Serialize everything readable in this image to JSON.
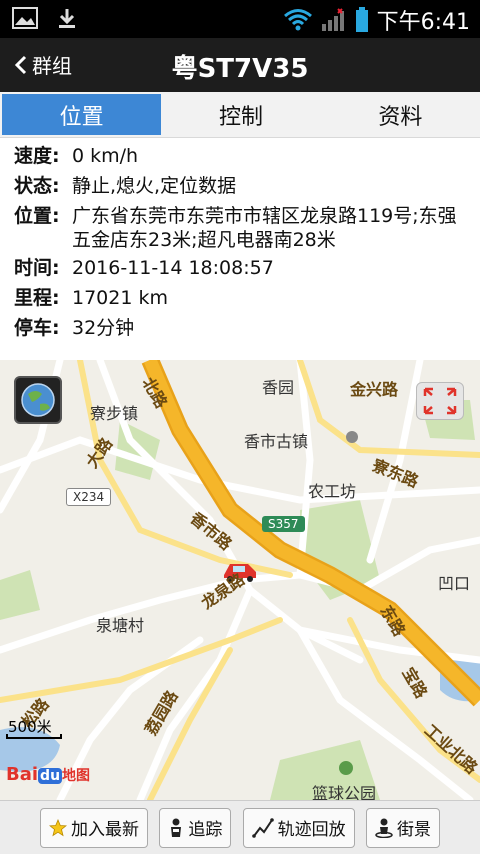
{
  "status_bar": {
    "time": "下午6:41",
    "icons": [
      "image-icon",
      "download-icon",
      "wifi-icon",
      "signal-icon",
      "battery-icon"
    ]
  },
  "header": {
    "back_label": "群组",
    "title": "粤ST7V35"
  },
  "tabs": [
    {
      "label": "位置",
      "active": true
    },
    {
      "label": "控制",
      "active": false
    },
    {
      "label": "资料",
      "active": false
    }
  ],
  "info": {
    "speed": {
      "label": "速度:",
      "value": "0 km/h"
    },
    "state": {
      "label": "状态:",
      "value": "静止,熄火,定位数据"
    },
    "location": {
      "label": "位置:",
      "value": "广东省东莞市东莞市市辖区龙泉路119号;东强五金店东23米;超凡电器南28米"
    },
    "time": {
      "label": "时间:",
      "value": "2016-11-14 18:08:57"
    },
    "mileage": {
      "label": "里程:",
      "value": "17021 km"
    },
    "parking": {
      "label": "停车:",
      "value": "32分钟"
    }
  },
  "map": {
    "places": {
      "liaobu": "寮步镇",
      "xiangyuan": "香园",
      "jinxing": "金兴路",
      "xiangshi_guzhen": "香市古镇",
      "nonggongfang": "农工坊",
      "quantang": "泉塘村",
      "aokou": "凹口",
      "lanqiu": "篮球公园"
    },
    "roads": {
      "xiangshi": "香市路",
      "longquan": "龙泉路",
      "liaodong": "寮东路",
      "gongye_north": "工业北路",
      "lizhi": "荔园路",
      "song": "松路",
      "dong": "东路",
      "bao": "宝路",
      "dachuan": "大路",
      "north": "北路"
    },
    "badges": {
      "x234": "X234",
      "s357": "S357"
    },
    "scale_label": "500米",
    "baidu_logo": {
      "bai": "Bai",
      "du": "du",
      "ditu": "地图"
    },
    "colors": {
      "road": "#ffffff",
      "highway": "#f5b62a",
      "water": "#a6c8e8",
      "green": "#cfe3b4",
      "car": "#e0332b"
    }
  },
  "toolbar": {
    "buttons": [
      {
        "label": "加入最新",
        "icon": "star-icon"
      },
      {
        "label": "追踪",
        "icon": "person-icon"
      },
      {
        "label": "轨迹回放",
        "icon": "track-icon"
      },
      {
        "label": "街景",
        "icon": "streetview-icon"
      }
    ]
  }
}
